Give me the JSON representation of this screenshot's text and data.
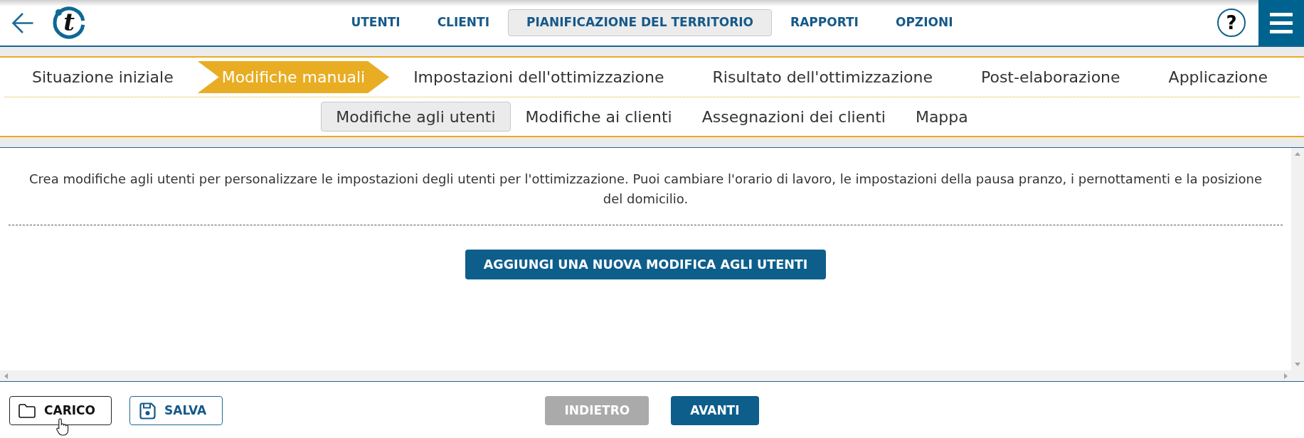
{
  "header": {
    "logo": {
      "letter": "t"
    },
    "nav": [
      {
        "label": "UTENTI",
        "selected": false
      },
      {
        "label": "CLIENTI",
        "selected": false
      },
      {
        "label": "PIANIFICAZIONE DEL TERRITORIO",
        "selected": true
      },
      {
        "label": "RAPPORTI",
        "selected": false
      },
      {
        "label": "OPZIONI",
        "selected": false
      }
    ],
    "help_label": "?"
  },
  "steps": [
    {
      "label": "Situazione iniziale",
      "selected": false
    },
    {
      "label": "Modifiche manuali",
      "selected": true
    },
    {
      "label": "Impostazioni dell'ottimizzazione",
      "selected": false
    },
    {
      "label": "Risultato dell'ottimizzazione",
      "selected": false
    },
    {
      "label": "Post-elaborazione",
      "selected": false
    },
    {
      "label": "Applicazione",
      "selected": false
    }
  ],
  "sub_tabs": [
    {
      "label": "Modifiche agli utenti",
      "selected": true
    },
    {
      "label": "Modifiche ai clienti",
      "selected": false
    },
    {
      "label": "Assegnazioni dei clienti",
      "selected": false
    },
    {
      "label": "Mappa",
      "selected": false
    }
  ],
  "content": {
    "description": "Crea modifiche agli utenti per personalizzare le impostazioni degli utenti per l'ottimizzazione. Puoi cambiare l'orario di lavoro, le impostazioni della pausa pranzo, i pernottamenti e la posizione del domicilio.",
    "add_button": "AGGIUNGI UNA NUOVA MODIFICA AGLI UTENTI"
  },
  "footer": {
    "file_buttons": [
      {
        "kind": "load",
        "label": "CARICO",
        "hovered": true
      },
      {
        "kind": "save",
        "label": "SALVA",
        "hovered": false
      }
    ],
    "nav_buttons": [
      {
        "label": "INDIETRO",
        "disabled": true
      },
      {
        "label": "AVANTI",
        "disabled": false
      }
    ]
  }
}
